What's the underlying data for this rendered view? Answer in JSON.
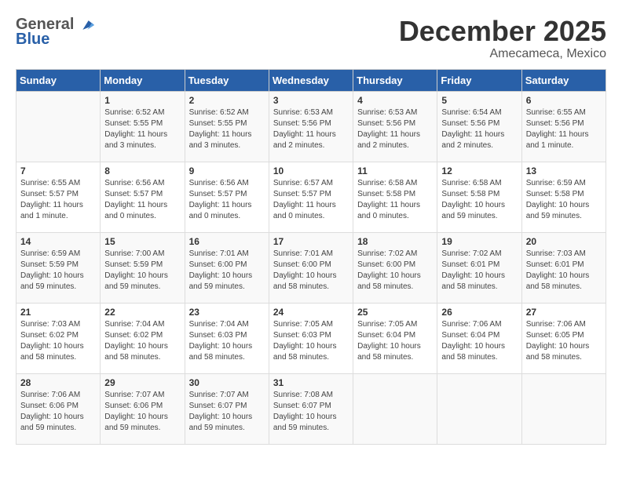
{
  "logo": {
    "general": "General",
    "blue": "Blue"
  },
  "title": "December 2025",
  "location": "Amecameca, Mexico",
  "headers": [
    "Sunday",
    "Monday",
    "Tuesday",
    "Wednesday",
    "Thursday",
    "Friday",
    "Saturday"
  ],
  "weeks": [
    [
      {
        "day": "",
        "info": ""
      },
      {
        "day": "1",
        "info": "Sunrise: 6:52 AM\nSunset: 5:55 PM\nDaylight: 11 hours\nand 3 minutes."
      },
      {
        "day": "2",
        "info": "Sunrise: 6:52 AM\nSunset: 5:55 PM\nDaylight: 11 hours\nand 3 minutes."
      },
      {
        "day": "3",
        "info": "Sunrise: 6:53 AM\nSunset: 5:56 PM\nDaylight: 11 hours\nand 2 minutes."
      },
      {
        "day": "4",
        "info": "Sunrise: 6:53 AM\nSunset: 5:56 PM\nDaylight: 11 hours\nand 2 minutes."
      },
      {
        "day": "5",
        "info": "Sunrise: 6:54 AM\nSunset: 5:56 PM\nDaylight: 11 hours\nand 2 minutes."
      },
      {
        "day": "6",
        "info": "Sunrise: 6:55 AM\nSunset: 5:56 PM\nDaylight: 11 hours\nand 1 minute."
      }
    ],
    [
      {
        "day": "7",
        "info": "Sunrise: 6:55 AM\nSunset: 5:57 PM\nDaylight: 11 hours\nand 1 minute."
      },
      {
        "day": "8",
        "info": "Sunrise: 6:56 AM\nSunset: 5:57 PM\nDaylight: 11 hours\nand 0 minutes."
      },
      {
        "day": "9",
        "info": "Sunrise: 6:56 AM\nSunset: 5:57 PM\nDaylight: 11 hours\nand 0 minutes."
      },
      {
        "day": "10",
        "info": "Sunrise: 6:57 AM\nSunset: 5:57 PM\nDaylight: 11 hours\nand 0 minutes."
      },
      {
        "day": "11",
        "info": "Sunrise: 6:58 AM\nSunset: 5:58 PM\nDaylight: 11 hours\nand 0 minutes."
      },
      {
        "day": "12",
        "info": "Sunrise: 6:58 AM\nSunset: 5:58 PM\nDaylight: 10 hours\nand 59 minutes."
      },
      {
        "day": "13",
        "info": "Sunrise: 6:59 AM\nSunset: 5:58 PM\nDaylight: 10 hours\nand 59 minutes."
      }
    ],
    [
      {
        "day": "14",
        "info": "Sunrise: 6:59 AM\nSunset: 5:59 PM\nDaylight: 10 hours\nand 59 minutes."
      },
      {
        "day": "15",
        "info": "Sunrise: 7:00 AM\nSunset: 5:59 PM\nDaylight: 10 hours\nand 59 minutes."
      },
      {
        "day": "16",
        "info": "Sunrise: 7:01 AM\nSunset: 6:00 PM\nDaylight: 10 hours\nand 59 minutes."
      },
      {
        "day": "17",
        "info": "Sunrise: 7:01 AM\nSunset: 6:00 PM\nDaylight: 10 hours\nand 58 minutes."
      },
      {
        "day": "18",
        "info": "Sunrise: 7:02 AM\nSunset: 6:00 PM\nDaylight: 10 hours\nand 58 minutes."
      },
      {
        "day": "19",
        "info": "Sunrise: 7:02 AM\nSunset: 6:01 PM\nDaylight: 10 hours\nand 58 minutes."
      },
      {
        "day": "20",
        "info": "Sunrise: 7:03 AM\nSunset: 6:01 PM\nDaylight: 10 hours\nand 58 minutes."
      }
    ],
    [
      {
        "day": "21",
        "info": "Sunrise: 7:03 AM\nSunset: 6:02 PM\nDaylight: 10 hours\nand 58 minutes."
      },
      {
        "day": "22",
        "info": "Sunrise: 7:04 AM\nSunset: 6:02 PM\nDaylight: 10 hours\nand 58 minutes."
      },
      {
        "day": "23",
        "info": "Sunrise: 7:04 AM\nSunset: 6:03 PM\nDaylight: 10 hours\nand 58 minutes."
      },
      {
        "day": "24",
        "info": "Sunrise: 7:05 AM\nSunset: 6:03 PM\nDaylight: 10 hours\nand 58 minutes."
      },
      {
        "day": "25",
        "info": "Sunrise: 7:05 AM\nSunset: 6:04 PM\nDaylight: 10 hours\nand 58 minutes."
      },
      {
        "day": "26",
        "info": "Sunrise: 7:06 AM\nSunset: 6:04 PM\nDaylight: 10 hours\nand 58 minutes."
      },
      {
        "day": "27",
        "info": "Sunrise: 7:06 AM\nSunset: 6:05 PM\nDaylight: 10 hours\nand 58 minutes."
      }
    ],
    [
      {
        "day": "28",
        "info": "Sunrise: 7:06 AM\nSunset: 6:06 PM\nDaylight: 10 hours\nand 59 minutes."
      },
      {
        "day": "29",
        "info": "Sunrise: 7:07 AM\nSunset: 6:06 PM\nDaylight: 10 hours\nand 59 minutes."
      },
      {
        "day": "30",
        "info": "Sunrise: 7:07 AM\nSunset: 6:07 PM\nDaylight: 10 hours\nand 59 minutes."
      },
      {
        "day": "31",
        "info": "Sunrise: 7:08 AM\nSunset: 6:07 PM\nDaylight: 10 hours\nand 59 minutes."
      },
      {
        "day": "",
        "info": ""
      },
      {
        "day": "",
        "info": ""
      },
      {
        "day": "",
        "info": ""
      }
    ]
  ]
}
